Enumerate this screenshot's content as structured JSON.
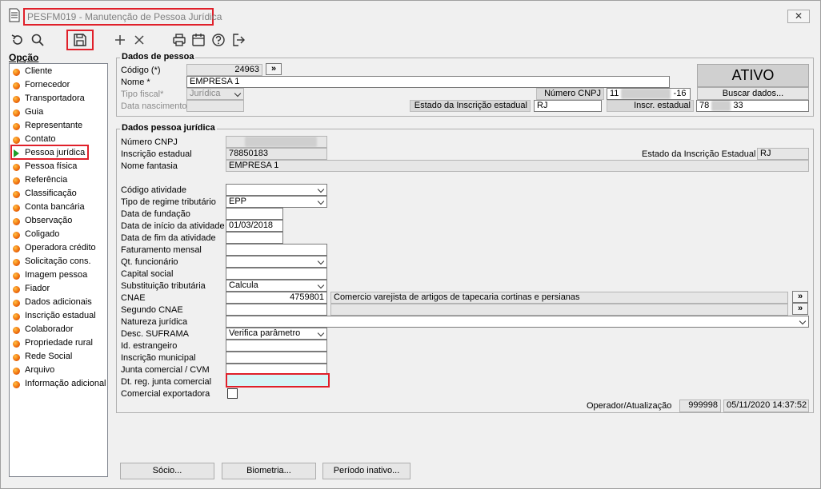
{
  "window": {
    "title": "PESFM019 - Manutenção de Pessoa Jurídica",
    "close_label": "✕"
  },
  "toolbar": {
    "icons": [
      "undo-icon",
      "search-icon",
      "save-icon",
      "add-icon",
      "delete-icon",
      "print-icon",
      "calendar-icon",
      "help-icon",
      "exit-icon"
    ]
  },
  "sidebar": {
    "title": "Opção",
    "items": [
      {
        "label": "Cliente"
      },
      {
        "label": "Fornecedor"
      },
      {
        "label": "Transportadora"
      },
      {
        "label": "Guia"
      },
      {
        "label": "Representante"
      },
      {
        "label": "Contato"
      },
      {
        "label": "Pessoa jurídica"
      },
      {
        "label": "Pessoa física"
      },
      {
        "label": "Referência"
      },
      {
        "label": "Classificação"
      },
      {
        "label": "Conta bancária"
      },
      {
        "label": "Observação"
      },
      {
        "label": "Coligado"
      },
      {
        "label": "Operadora crédito"
      },
      {
        "label": "Solicitação cons."
      },
      {
        "label": "Imagem pessoa"
      },
      {
        "label": "Fiador"
      },
      {
        "label": "Dados adicionais"
      },
      {
        "label": "Inscrição estadual"
      },
      {
        "label": "Colaborador"
      },
      {
        "label": "Propriedade rural"
      },
      {
        "label": "Rede Social"
      },
      {
        "label": "Arquivo"
      },
      {
        "label": "Informação adicional"
      }
    ],
    "selected_index": 6
  },
  "dados_pessoa": {
    "title": "Dados de pessoa",
    "codigo_label": "Código (*)",
    "codigo_value": "24963",
    "expand_label": "»",
    "nome_label": "Nome *",
    "nome_value": "EMPRESA 1",
    "tipo_fiscal_label": "Tipo fiscal*",
    "tipo_fiscal_value": "Jurídica",
    "data_nascimento_label": "Data nascimento",
    "numero_cnpj_label": "Número CNPJ",
    "cnpj_prefix": "11",
    "cnpj_suffix": "-16",
    "estado_ie_label": "Estado da Inscrição estadual",
    "estado_ie_value": "RJ",
    "inscr_estadual_label": "Inscr. estadual",
    "inscr_prefix": "78",
    "inscr_suffix": "33",
    "status": "ATIVO",
    "buscar_label": "Buscar dados..."
  },
  "dados_juridica": {
    "title": "Dados pessoa jurídica",
    "numero_cnpj_label": "Número CNPJ",
    "inscricao_estadual_label": "Inscrição estadual",
    "inscricao_estadual_value": "78850183",
    "estado_ie_label": "Estado da Inscrição Estadual",
    "estado_ie_value": "RJ",
    "nome_fantasia_label": "Nome fantasia",
    "nome_fantasia_value": "EMPRESA 1",
    "codigo_atividade_label": "Código atividade",
    "regime_label": "Tipo de regime tributário",
    "regime_value": "EPP",
    "fundacao_label": "Data de fundação",
    "inicio_label": "Data de início da atividade",
    "inicio_value": "01/03/2018",
    "fim_label": "Data de fim da atividade",
    "faturamento_label": "Faturamento mensal",
    "qt_func_label": "Qt. funcionário",
    "capital_label": "Capital social",
    "subst_label": "Substituição tributária",
    "subst_value": "Calcula",
    "cnae_label": "CNAE",
    "cnae_value": "4759801",
    "cnae_desc": "Comercio varejista de artigos de tapecaria  cortinas e persianas",
    "segundo_cnae_label": "Segundo CNAE",
    "natureza_label": "Natureza jurídica",
    "suframa_label": "Desc. SUFRAMA",
    "suframa_value": "Verifica parâmetro",
    "id_estrangeiro_label": "Id. estrangeiro",
    "insc_municipal_label": "Inscrição municipal",
    "junta_label": "Junta comercial / CVM",
    "dt_junta_label": "Dt. reg. junta comercial",
    "exportadora_label": "Comercial exportadora",
    "operador_label": "Operador/Atualização",
    "operador_value": "999998",
    "atualizacao_value": "05/11/2020 14:37:52"
  },
  "buttons": {
    "socio": "Sócio...",
    "biometria": "Biometria...",
    "periodo": "Período inativo..."
  }
}
